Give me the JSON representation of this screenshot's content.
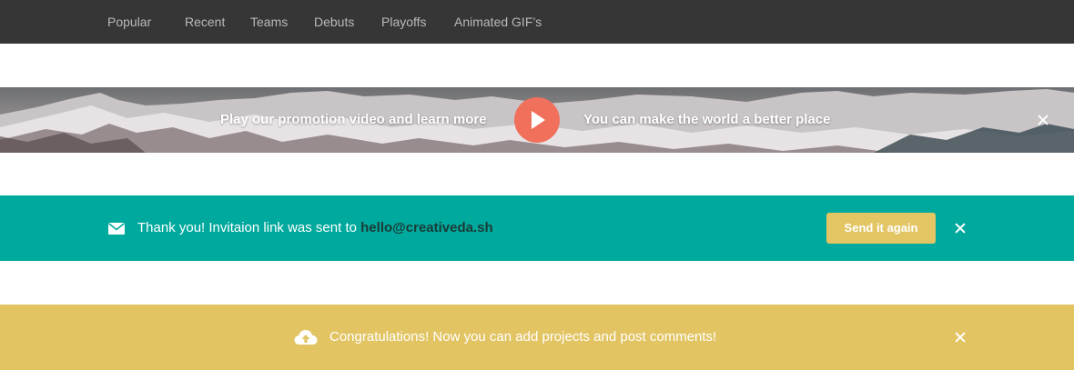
{
  "nav": {
    "items": [
      {
        "label": "Popular"
      },
      {
        "label": "Recent"
      },
      {
        "label": "Teams"
      },
      {
        "label": "Debuts"
      },
      {
        "label": "Playoffs"
      },
      {
        "label": "Animated GIF’s"
      }
    ]
  },
  "promo": {
    "left_text": "Play our promotion video and learn more",
    "right_text": "You can make the world a better place",
    "play_icon": "play-icon",
    "close_icon": "close-icon",
    "accent_color": "#f0705c"
  },
  "invite_notice": {
    "message": "Thank you! Invitaion link was sent to ",
    "email": "hello@creativeda.sh",
    "button_label": "Send it again",
    "icon": "mail-icon",
    "close_icon": "close-icon",
    "background_color": "#00a99d",
    "button_color": "#e3c563"
  },
  "success_notice": {
    "message": "Congratulations! Now you can add projects and post comments!",
    "icon": "cloud-upload-icon",
    "close_icon": "close-icon",
    "background_color": "#e2c463"
  }
}
